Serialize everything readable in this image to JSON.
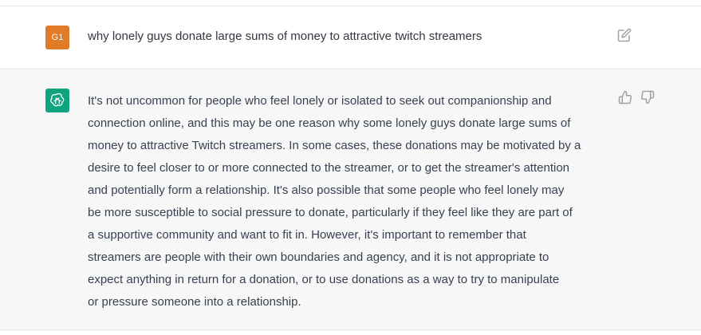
{
  "user_message": {
    "avatar_initials": "G1",
    "avatar_color": "#e07b2a",
    "text": "why lonely guys donate large sums of money to attractive twitch streamers",
    "edit_icon": "edit-icon"
  },
  "assistant_message": {
    "avatar_icon": "openai-logo-icon",
    "avatar_color": "#10a37f",
    "lines": [
      "It's not uncommon for people who feel lonely or isolated to seek out companionship and",
      "connection online, and this may be one reason why some lonely guys donate large sums of",
      "money to attractive Twitch streamers. In some cases, these donations may be motivated by a",
      "desire to feel closer to or more connected to the streamer, or to get the streamer's attention",
      "and potentially form a relationship. It's also possible that some people who feel lonely may",
      "be more susceptible to social pressure to donate, particularly if they feel like they are part of",
      "a supportive community and want to fit in. However, it's important to remember that",
      "streamers are people with their own boundaries and agency, and it is not appropriate to",
      "expect anything in return for a donation, or to use donations as a way to try to manipulate",
      "or pressure someone into a relationship."
    ],
    "feedback_icons": [
      "thumbs-up-icon",
      "thumbs-down-icon"
    ]
  }
}
